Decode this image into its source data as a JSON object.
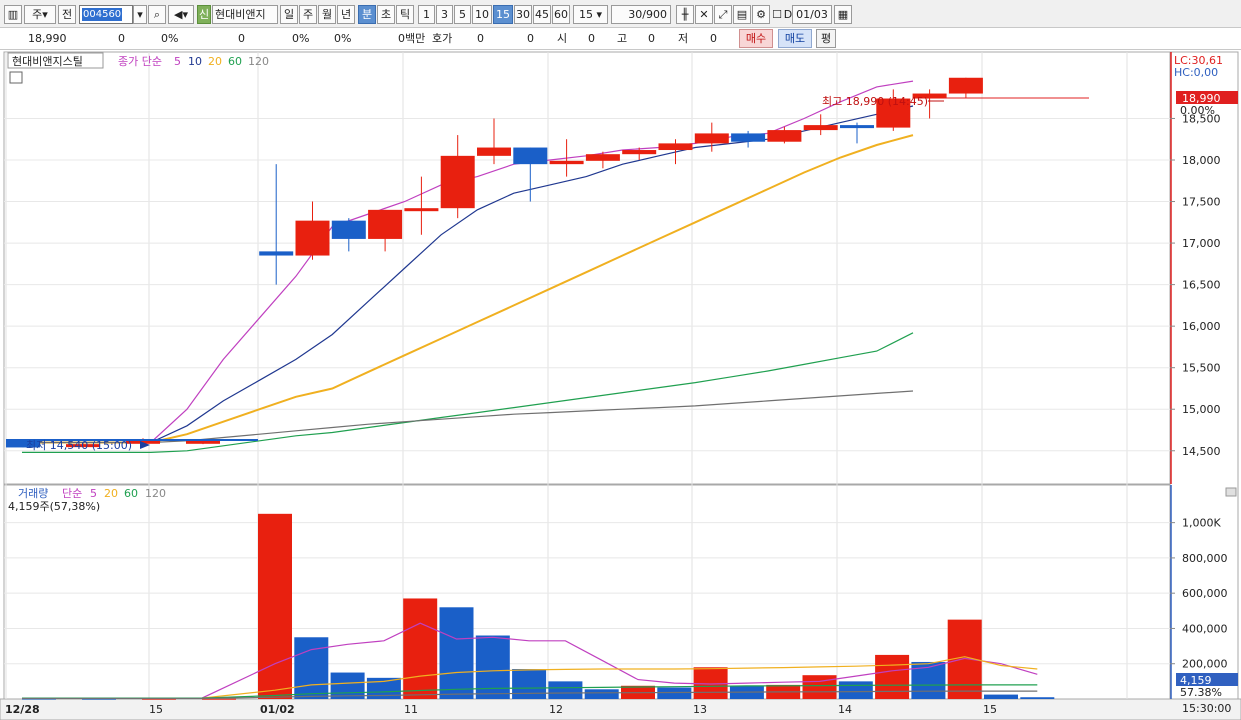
{
  "toolbar": {
    "type_label": "주",
    "range_label": "전",
    "stock_code": "004560",
    "stock_name": "현대비앤지",
    "new_badge": "신",
    "period_day": "일",
    "period_week": "주",
    "period_month": "월",
    "period_year": "년",
    "period_minute": "분",
    "period_second": "초",
    "period_tick": "틱",
    "intervals": [
      "1",
      "3",
      "5",
      "10",
      "15",
      "30",
      "45",
      "60"
    ],
    "interval_value": "15",
    "count_value": "30",
    "count_total": "/900",
    "date_value": "01/03",
    "date_check": "D"
  },
  "quote": {
    "price": "18,990",
    "change": "0",
    "change_pct": "0%",
    "volume": "0",
    "pct2": "0%",
    "pct3": "0%",
    "amount": "0백만",
    "ask_label": "호가",
    "ask_val1": "0",
    "ask_val2": "0",
    "open_label": "시",
    "open_val": "0",
    "high_label": "고",
    "high_val": "0",
    "low_label": "저",
    "low_val": "0",
    "buy_button": "매수",
    "sell_button": "매도",
    "eval_button": "평"
  },
  "colors": {
    "up": "#e8200f",
    "down": "#1a5fc8",
    "ma5": "#c040c0",
    "ma10": "#203890",
    "ma20": "#f0b020",
    "ma60": "#20a050",
    "ma120": "#707070"
  },
  "price_panel": {
    "legend_stock": "현대비앤지스틸",
    "legend_type": "종가 단순",
    "ma_labels": [
      "5",
      "10",
      "20",
      "60",
      "120"
    ],
    "lc_label": "LC:30,61",
    "hc_label": "HC:0,00",
    "high_annotation": "최고 18,990 (14:45)",
    "low_annotation": "최저 14,540 (15:00)",
    "current_tag": "18,990",
    "current_pct": "0.00%"
  },
  "volume_panel": {
    "legend_title": "거래량",
    "legend_type": "단순",
    "ma_labels": [
      "5",
      "20",
      "60",
      "120"
    ],
    "sub_label": "4,159주(57,38%)",
    "current_tag": "4,159",
    "current_pct": "57.38%"
  },
  "x_axis": {
    "labels": [
      "12/28",
      "15",
      "01/02",
      "11",
      "12",
      "13",
      "14",
      "15"
    ],
    "right_label": "15:30:00"
  },
  "chart_data": [
    {
      "type": "candlestick",
      "title": "현대비앤지스틸",
      "y_ticks": [
        "18,500",
        "18,000",
        "17,500",
        "17,000",
        "16,500",
        "16,000",
        "15,500",
        "15,000",
        "14,500"
      ],
      "ylim": [
        14100,
        19300
      ],
      "candles": [
        {
          "o": 14620,
          "h": 14620,
          "l": 14540,
          "c": 14540
        },
        {
          "o": 14580,
          "h": 14600,
          "l": 14540,
          "c": 14580
        },
        {
          "o": 14620,
          "h": 14650,
          "l": 14560,
          "c": 14620
        },
        {
          "o": 14620,
          "h": 14640,
          "l": 14580,
          "c": 14620
        },
        {
          "o": 16900,
          "h": 17950,
          "l": 16500,
          "c": 16850
        },
        {
          "o": 16850,
          "h": 17500,
          "l": 16800,
          "c": 17270
        },
        {
          "o": 17270,
          "h": 17300,
          "l": 16900,
          "c": 17050
        },
        {
          "o": 17050,
          "h": 17400,
          "l": 16900,
          "c": 17400
        },
        {
          "o": 17400,
          "h": 17800,
          "l": 17100,
          "c": 17420
        },
        {
          "o": 17420,
          "h": 18300,
          "l": 17300,
          "c": 18050
        },
        {
          "o": 18050,
          "h": 18500,
          "l": 17950,
          "c": 18150
        },
        {
          "o": 18150,
          "h": 18150,
          "l": 17500,
          "c": 17950
        },
        {
          "o": 17950,
          "h": 18250,
          "l": 17800,
          "c": 17990
        },
        {
          "o": 17990,
          "h": 18100,
          "l": 17900,
          "c": 18070
        },
        {
          "o": 18070,
          "h": 18150,
          "l": 18000,
          "c": 18120
        },
        {
          "o": 18120,
          "h": 18250,
          "l": 17950,
          "c": 18200
        },
        {
          "o": 18200,
          "h": 18450,
          "l": 18100,
          "c": 18320
        },
        {
          "o": 18320,
          "h": 18350,
          "l": 18150,
          "c": 18220
        },
        {
          "o": 18220,
          "h": 18400,
          "l": 18200,
          "c": 18360
        },
        {
          "o": 18360,
          "h": 18550,
          "l": 18300,
          "c": 18420
        },
        {
          "o": 18420,
          "h": 18450,
          "l": 18200,
          "c": 18390
        },
        {
          "o": 18390,
          "h": 18850,
          "l": 18350,
          "c": 18740
        },
        {
          "o": 18740,
          "h": 18850,
          "l": 18500,
          "c": 18800
        },
        {
          "o": 18800,
          "h": 18990,
          "l": 18750,
          "c": 18990
        }
      ],
      "series": [
        {
          "name": "5",
          "values": [
            14600,
            14600,
            14600,
            14600,
            15000,
            15600,
            16100,
            16600,
            17200,
            17350,
            17500,
            17700,
            17800,
            17950,
            18000,
            18050,
            18120,
            18150,
            18200,
            18280,
            18320,
            18500,
            18700,
            18880,
            18950
          ]
        },
        {
          "name": "10",
          "values": [
            14600,
            14600,
            14600,
            14600,
            14800,
            15100,
            15350,
            15600,
            15900,
            16300,
            16700,
            17100,
            17400,
            17600,
            17700,
            17800,
            17950,
            18050,
            18150,
            18200,
            18250,
            18350,
            18450,
            18550,
            18650
          ]
        },
        {
          "name": "20",
          "values": [
            14600,
            14600,
            14600,
            14600,
            14700,
            14850,
            15000,
            15150,
            15250,
            15450,
            15650,
            15850,
            16050,
            16250,
            16450,
            16650,
            16850,
            17050,
            17250,
            17450,
            17650,
            17850,
            18030,
            18180,
            18300
          ]
        },
        {
          "name": "60",
          "values": [
            14480,
            14480,
            14480,
            14480,
            14500,
            14560,
            14620,
            14680,
            14720,
            14780,
            14840,
            14900,
            14960,
            15020,
            15080,
            15140,
            15200,
            15260,
            15320,
            15390,
            15460,
            15540,
            15620,
            15700,
            15920
          ]
        },
        {
          "name": "120",
          "values": [
            14600,
            14600,
            14600,
            14600,
            14620,
            14660,
            14700,
            14740,
            14780,
            14820,
            14850,
            14880,
            14910,
            14940,
            14960,
            14980,
            15000,
            15020,
            15040,
            15070,
            15100,
            15130,
            15160,
            15190,
            15220
          ]
        }
      ]
    },
    {
      "type": "bar",
      "title": "거래량",
      "y_ticks": [
        "1,000K",
        "800,000",
        "600,000",
        "400,000",
        "200,000"
      ],
      "ylim": [
        0,
        1100000
      ],
      "values": [
        2000,
        1500,
        1500,
        1500,
        1050000,
        350000,
        150000,
        120000,
        570000,
        520000,
        360000,
        170000,
        100000,
        55000,
        75000,
        65000,
        180000,
        75000,
        80000,
        135000,
        100000,
        250000,
        210000,
        450000,
        25000,
        10000
      ],
      "directions": [
        "d",
        "d",
        "u",
        "u",
        "u",
        "d",
        "d",
        "d",
        "u",
        "d",
        "d",
        "d",
        "d",
        "d",
        "u",
        "d",
        "u",
        "d",
        "u",
        "u",
        "d",
        "u",
        "d",
        "u",
        "d",
        "d"
      ],
      "series": [
        {
          "name": "5",
          "values": [
            5000,
            5000,
            5000,
            5000,
            200000,
            280000,
            310000,
            330000,
            430000,
            340000,
            350000,
            330000,
            330000,
            220000,
            110000,
            90000,
            85000,
            90000,
            95000,
            100000,
            130000,
            160000,
            180000,
            230000,
            200000,
            140000
          ]
        },
        {
          "name": "20",
          "values": [
            5000,
            5000,
            5000,
            5000,
            50000,
            80000,
            90000,
            100000,
            130000,
            150000,
            160000,
            165000,
            168000,
            170000,
            170000,
            170000,
            172000,
            175000,
            178000,
            182000,
            186000,
            192000,
            200000,
            240000,
            190000,
            170000
          ]
        },
        {
          "name": "60",
          "values": [
            5000,
            5000,
            5000,
            5000,
            20000,
            30000,
            35000,
            40000,
            48000,
            55000,
            60000,
            62000,
            64000,
            66000,
            68000,
            70000,
            72000,
            74000,
            75000,
            76000,
            77000,
            78000,
            79000,
            80000,
            80000,
            80000
          ]
        },
        {
          "name": "120",
          "values": [
            3000,
            3000,
            3000,
            3000,
            10000,
            15000,
            18000,
            20000,
            24000,
            28000,
            30000,
            32000,
            34000,
            35000,
            36000,
            37000,
            38000,
            39000,
            40000,
            41000,
            42000,
            43000,
            44000,
            45000,
            45000,
            45000
          ]
        }
      ]
    }
  ]
}
